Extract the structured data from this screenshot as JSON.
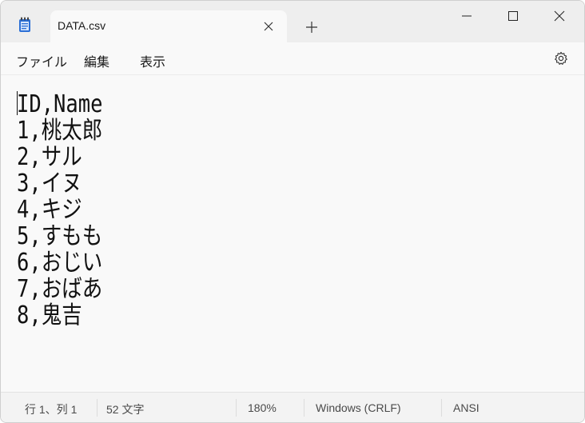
{
  "tab": {
    "title": "DATA.csv"
  },
  "menu": {
    "file": "ファイル",
    "edit": "編集",
    "view": "表示"
  },
  "editor": {
    "lines": [
      "ID,Name",
      "1,桃太郎",
      "2,サル",
      "3,イヌ",
      "4,キジ",
      "5,すもも",
      "6,おじい",
      "7,おばあ",
      "8,鬼吉"
    ]
  },
  "status": {
    "position": "行 1、列 1",
    "char_count": "52 文字",
    "zoom": "180%",
    "line_ending": "Windows (CRLF)",
    "encoding": "ANSI"
  },
  "icons": {
    "app": "notepad-icon",
    "close_tab": "close-icon",
    "new_tab": "plus-icon",
    "minimize": "minimize-icon",
    "maximize": "maximize-icon",
    "close_window": "close-icon",
    "settings": "gear-icon"
  },
  "colors": {
    "accent": "#2b6fd6",
    "titlebar": "#eeeeee",
    "editor_bg": "#f9f9f9"
  }
}
